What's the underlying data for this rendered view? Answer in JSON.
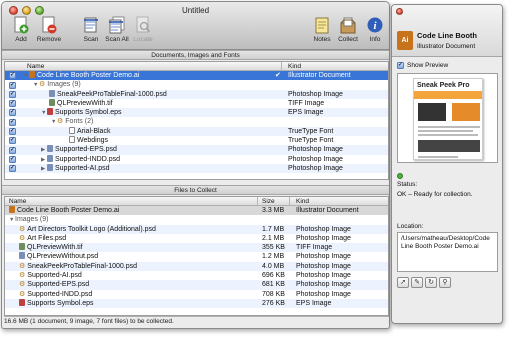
{
  "window": {
    "title": "Untitled"
  },
  "toolbar": {
    "add": "Add",
    "remove": "Remove",
    "scan": "Scan",
    "scan_all": "Scan All",
    "locate": "Locate",
    "notes": "Notes",
    "collect": "Collect",
    "info": "Info"
  },
  "top_section": {
    "title": "Documents, Images and Fonts",
    "col_name": "Name",
    "col_kind": "Kind",
    "rows": [
      {
        "name": "Code Line Booth Poster Demo.ai",
        "kind": "Illustrator Document"
      },
      {
        "name": "Images (9)",
        "kind": ""
      },
      {
        "name": "SneakPeekProTableFinal-1000.psd",
        "kind": "Photoshop Image"
      },
      {
        "name": "QLPreviewWith.tif",
        "kind": "TIFF Image"
      },
      {
        "name": "Supports Symbol.eps",
        "kind": "EPS Image"
      },
      {
        "name": "Fonts (2)",
        "kind": ""
      },
      {
        "name": "Arial-Black",
        "kind": "TrueType Font"
      },
      {
        "name": "Webdings",
        "kind": "TrueType Font"
      },
      {
        "name": "Supported-EPS.psd",
        "kind": "Photoshop Image"
      },
      {
        "name": "Supported-INDD.psd",
        "kind": "Photoshop Image"
      },
      {
        "name": "Supported-AI.psd",
        "kind": "Photoshop Image"
      }
    ]
  },
  "bottom_section": {
    "title": "Files to Collect",
    "col_name": "Name",
    "col_size": "Size",
    "col_kind": "Kind",
    "rows": [
      {
        "name": "Code Line Booth Poster Demo.ai",
        "size": "3.3 MB",
        "kind": "Illustrator Document"
      },
      {
        "name": "Images (9)",
        "size": "",
        "kind": ""
      },
      {
        "name": "Art Directors Toolkit Logo (Additional).psd",
        "size": "1.7 MB",
        "kind": "Photoshop Image"
      },
      {
        "name": "Art Files.psd",
        "size": "2.1 MB",
        "kind": "Photoshop Image"
      },
      {
        "name": "QLPreviewWith.tif",
        "size": "355 KB",
        "kind": "TIFF Image"
      },
      {
        "name": "QLPreviewWithout.psd",
        "size": "1.2 MB",
        "kind": "Photoshop Image"
      },
      {
        "name": "SneakPeekProTableFinal-1000.psd",
        "size": "4.0 MB",
        "kind": "Photoshop Image"
      },
      {
        "name": "Supported-AI.psd",
        "size": "696 KB",
        "kind": "Photoshop Image"
      },
      {
        "name": "Supported-EPS.psd",
        "size": "681 KB",
        "kind": "Photoshop Image"
      },
      {
        "name": "Supported-INDD.psd",
        "size": "708 KB",
        "kind": "Photoshop Image"
      },
      {
        "name": "Supports Symbol.eps",
        "size": "276 KB",
        "kind": "EPS Image"
      }
    ]
  },
  "status_bar": "16.6 MB (1 document, 9 image, 7 font files) to be collected.",
  "inspector": {
    "file_name": "Code Line Booth",
    "file_kind": "Illustrator Document",
    "show_preview": "Show Preview",
    "preview_logo": "Sneak Peek Pro",
    "status_label": "Status:",
    "status_value": "OK – Ready for collection.",
    "location_label": "Location:",
    "location_value": "/Users/matheau/Desktop/Code Line Booth Poster Demo.ai"
  },
  "colors": {
    "selection": "#3875d7",
    "alt_row": "#edf3fe",
    "ai_icon": "#c6731b"
  }
}
